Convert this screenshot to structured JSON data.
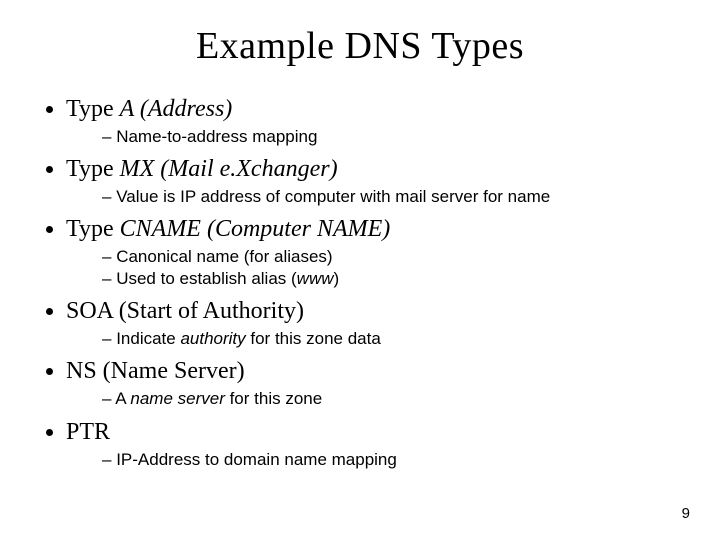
{
  "title": "Example DNS Types",
  "items": [
    {
      "label_pre": "Type ",
      "label_em": "A (Address)",
      "label_post": "",
      "subs": [
        {
          "pre": "Name-to-address mapping",
          "em": "",
          "post": ""
        }
      ]
    },
    {
      "label_pre": "Type ",
      "label_em": "MX (Mail e.Xchanger)",
      "label_post": "",
      "subs": [
        {
          "pre": "Value is IP address of computer with mail server for name",
          "em": "",
          "post": ""
        }
      ]
    },
    {
      "label_pre": "Type ",
      "label_em": "CNAME (Computer NAME)",
      "label_post": "",
      "subs": [
        {
          "pre": "Canonical name (for aliases)",
          "em": "",
          "post": ""
        },
        {
          "pre": "Used to establish alias (",
          "em": "www",
          "post": ")"
        }
      ]
    },
    {
      "label_pre": "SOA (Start of Authority)",
      "label_em": "",
      "label_post": "",
      "subs": [
        {
          "pre": "Indicate ",
          "em": "authority",
          "post": " for this zone data"
        }
      ]
    },
    {
      "label_pre": "NS (Name Server)",
      "label_em": "",
      "label_post": "",
      "subs": [
        {
          "pre": "A ",
          "em": "name server",
          "post": " for this zone"
        }
      ]
    },
    {
      "label_pre": "PTR",
      "label_em": "",
      "label_post": "",
      "subs": [
        {
          "pre": "IP-Address to domain name mapping",
          "em": "",
          "post": ""
        }
      ]
    }
  ],
  "page_number": "9"
}
